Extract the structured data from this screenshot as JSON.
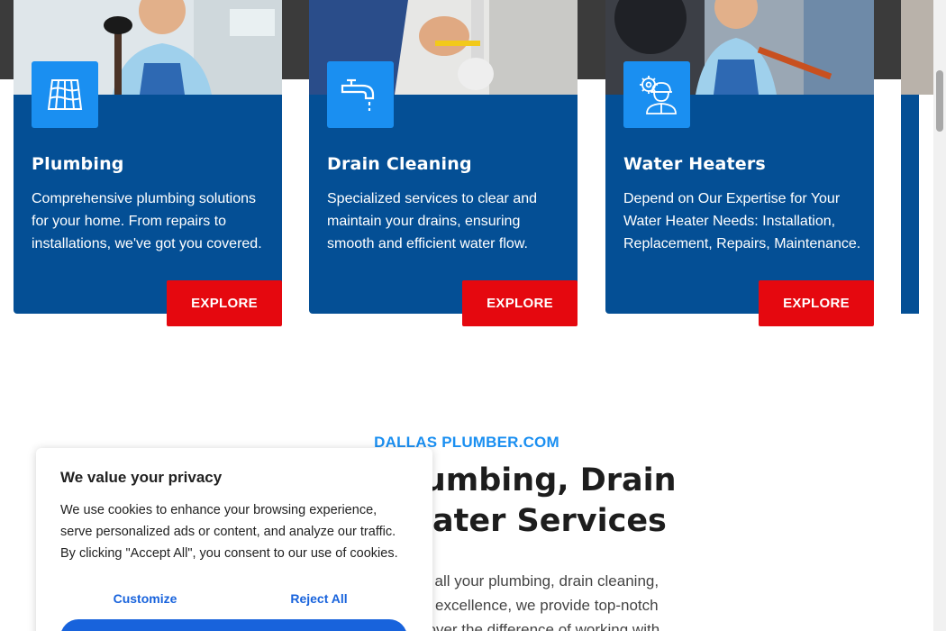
{
  "cards": [
    {
      "title": "Plumbing",
      "description": "Comprehensive plumbing solutions for your home. From repairs to installations, we've got you covered.",
      "button_label": "EXPLORE",
      "icon": "tiles-icon"
    },
    {
      "title": "Drain Cleaning",
      "description": "Specialized services to clear and maintain your drains, ensuring smooth and efficient water flow.",
      "button_label": "EXPLORE",
      "icon": "faucet-icon"
    },
    {
      "title": "Water Heaters",
      "description": "Depend on Our Expertise for Your Water Heater Needs: Installation, Replacement, Repairs, Maintenance.",
      "button_label": "EXPLORE",
      "icon": "worker-gear-icon"
    }
  ],
  "section": {
    "eyebrow": "DALLAS PLUMBER.COM",
    "heading_line1": "ner for Plumbing, Drain",
    "heading_line2": "Water Heater Services",
    "intro_line1": "your trusted partner for all your plumbing, drain cleaning,",
    "intro_line2": "e and a commitment to excellence, we provide top-notch",
    "intro_line3": "running smoothly. Discover the difference of working with"
  },
  "cookie_banner": {
    "title": "We value your privacy",
    "text": "We use cookies to enhance your browsing experience, serve personalized ads or content, and analyze our traffic. By clicking \"Accept All\", you consent to our use of cookies.",
    "customize_label": "Customize",
    "reject_label": "Reject All"
  },
  "colors": {
    "card_blue": "#044f95",
    "icon_blue": "#1a8ff1",
    "button_red": "#e5080f",
    "cookie_blue": "#1863dc"
  }
}
